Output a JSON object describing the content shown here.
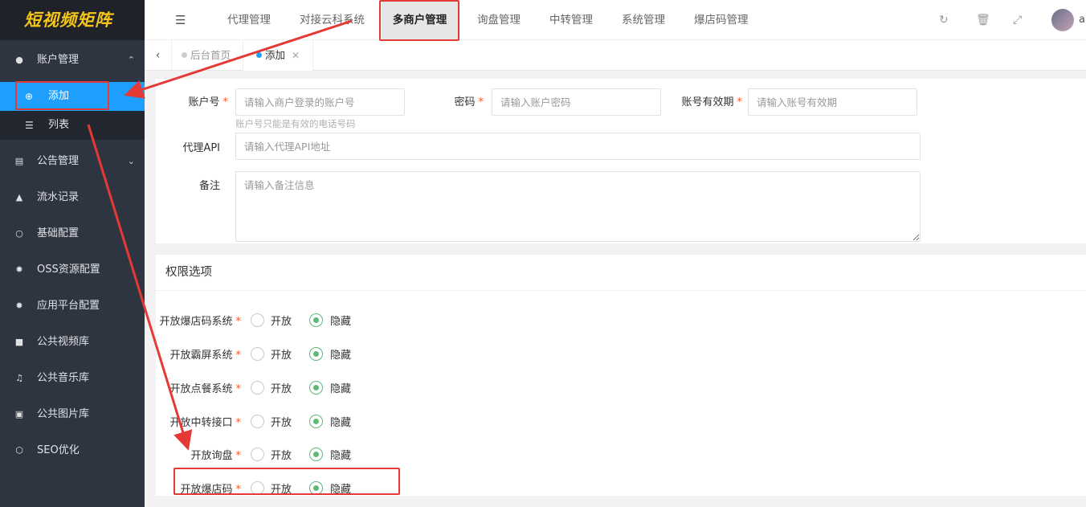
{
  "app": {
    "logo": "短视频矩阵"
  },
  "sidebar": {
    "groups": [
      {
        "label": "账户管理",
        "icon": "user-icon",
        "expanded": true
      },
      {
        "label": "公告管理",
        "icon": "card-icon",
        "expanded": false
      },
      {
        "label": "流水记录",
        "icon": "area-chart-icon"
      },
      {
        "label": "基础配置",
        "icon": "cc-icon"
      },
      {
        "label": "OSS资源配置",
        "icon": "gear-icon"
      },
      {
        "label": "应用平台配置",
        "icon": "gear-icon"
      },
      {
        "label": "公共视频库",
        "icon": "video-icon"
      },
      {
        "label": "公共音乐库",
        "icon": "music-icon"
      },
      {
        "label": "公共图片库",
        "icon": "image-icon"
      },
      {
        "label": "SEO优化",
        "icon": "cube-icon"
      }
    ],
    "subitems": [
      {
        "label": "添加",
        "icon": "plus-circle-icon",
        "active": true
      },
      {
        "label": "列表",
        "icon": "list-icon",
        "active": false
      }
    ]
  },
  "header": {
    "nav": [
      {
        "label": "代理管理"
      },
      {
        "label": "对接云科系统"
      },
      {
        "label": "多商户管理",
        "active": true
      },
      {
        "label": "询盘管理"
      },
      {
        "label": "中转管理"
      },
      {
        "label": "系统管理"
      },
      {
        "label": "爆店码管理"
      }
    ],
    "icons": [
      "refresh-icon",
      "trash-icon",
      "fullscreen-icon"
    ],
    "username": "a"
  },
  "tabs": [
    {
      "label": "后台首页",
      "active": false
    },
    {
      "label": "添加",
      "active": true
    }
  ],
  "form": {
    "account": {
      "label": "账户号",
      "placeholder": "请输入商户登录的账户号",
      "hint": "账户号只能是有效的电话号码"
    },
    "password": {
      "label": "密码",
      "placeholder": "请输入账户密码"
    },
    "expiry": {
      "label": "账号有效期",
      "placeholder": "请输入账号有效期"
    },
    "api": {
      "label": "代理API",
      "placeholder": "请输入代理API地址"
    },
    "remark": {
      "label": "备注",
      "placeholder": "请输入备注信息"
    }
  },
  "permissions": {
    "title": "权限选项",
    "open_label": "开放",
    "hide_label": "隐藏",
    "items": [
      {
        "label": "开放爆店码系统",
        "value": "隐藏"
      },
      {
        "label": "开放霸屏系统",
        "value": "隐藏"
      },
      {
        "label": "开放点餐系统",
        "value": "隐藏"
      },
      {
        "label": "开放中转接口",
        "value": "隐藏"
      },
      {
        "label": "开放询盘",
        "value": "隐藏"
      },
      {
        "label": "开放爆店码",
        "value": "隐藏"
      }
    ]
  },
  "annotation_color": "#e53935"
}
